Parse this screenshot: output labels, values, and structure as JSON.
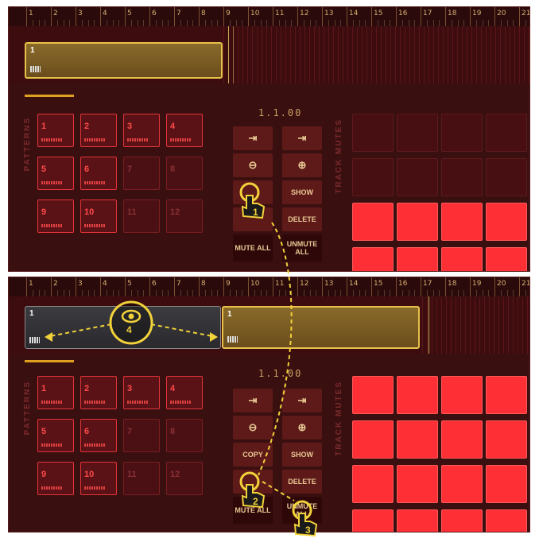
{
  "ruler": [
    "1",
    "2",
    "3",
    "4",
    "5",
    "6",
    "7",
    "8",
    "9",
    "10",
    "11",
    "12",
    "13",
    "14",
    "15",
    "16",
    "17",
    "18",
    "19",
    "20",
    "21"
  ],
  "top": {
    "clip_label": "1",
    "position": "1.1.00",
    "patterns_label": "PATTERNS",
    "track_mutes_label": "TRACK MUTES",
    "pads": [
      {
        "num": "1"
      },
      {
        "num": "2"
      },
      {
        "num": "3"
      },
      {
        "num": "4"
      },
      {
        "num": "5"
      },
      {
        "num": "6"
      },
      {
        "num": "7"
      },
      {
        "num": "8"
      },
      {
        "num": "9"
      },
      {
        "num": "10"
      },
      {
        "num": "11"
      },
      {
        "num": "12"
      }
    ],
    "buttons": {
      "show": "SHOW",
      "delete": "DELETE",
      "mute_all": "MUTE ALL",
      "unmute_all": "UNMUTE ALL"
    }
  },
  "bottom": {
    "clip_labels": [
      "1",
      "1"
    ],
    "position": "1.1.00",
    "patterns_label": "PATTERNS",
    "track_mutes_label": "TRACK MUTES",
    "pads": [
      {
        "num": "1"
      },
      {
        "num": "2"
      },
      {
        "num": "3"
      },
      {
        "num": "4"
      },
      {
        "num": "5"
      },
      {
        "num": "6"
      },
      {
        "num": "7"
      },
      {
        "num": "8"
      },
      {
        "num": "9"
      },
      {
        "num": "10"
      },
      {
        "num": "11"
      },
      {
        "num": "12"
      }
    ],
    "buttons": {
      "copy": "COPY",
      "show": "SHOW",
      "delete": "DELETE",
      "mute_all": "MUTE ALL",
      "unmute_all": "UNMUTE ALL"
    }
  },
  "callouts": [
    "1",
    "2",
    "3",
    "4"
  ],
  "colors": {
    "accent": "#e8c14a",
    "mute_on": "#ff2f36",
    "panel": "#3a0f10"
  }
}
